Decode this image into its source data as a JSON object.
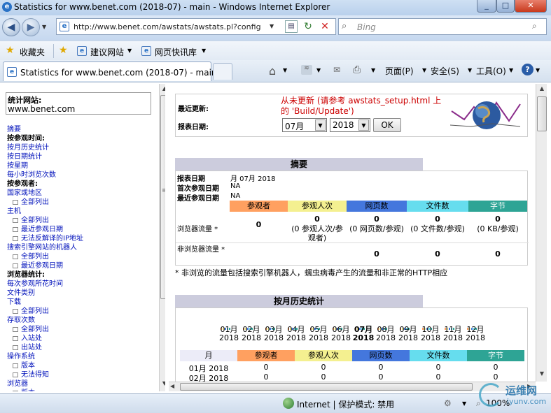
{
  "window": {
    "title": "Statistics for www.benet.com (2018-07) - main - Windows Internet Explorer"
  },
  "address": {
    "url": "http://www.benet.com/awstats/awstats.pl?config",
    "search_placeholder": "Bing"
  },
  "favorites": {
    "label": "收藏夹",
    "items": [
      "建议网站",
      "网页快讯库"
    ]
  },
  "tab": {
    "label": "Statistics for www.benet.com (2018-07) - main"
  },
  "commandbar": {
    "page": "页面(P)",
    "safety": "安全(S)",
    "tools": "工具(O)"
  },
  "sidebar": {
    "stats_label": "统计网站:",
    "site": "www.benet.com",
    "items": [
      {
        "text": "摘要",
        "kind": "link",
        "indent": false
      },
      {
        "text": "按参观时间:",
        "kind": "head",
        "indent": false
      },
      {
        "text": "按月历史统计",
        "kind": "link",
        "indent": false
      },
      {
        "text": "按日期统计",
        "kind": "link",
        "indent": false
      },
      {
        "text": "按星期",
        "kind": "link",
        "indent": false
      },
      {
        "text": "每小时浏览次数",
        "kind": "link",
        "indent": false
      },
      {
        "text": "按参观者:",
        "kind": "head",
        "indent": false
      },
      {
        "text": "国家或地区",
        "kind": "link",
        "indent": false
      },
      {
        "text": "全部列出",
        "kind": "link",
        "indent": true
      },
      {
        "text": "主机",
        "kind": "link",
        "indent": false
      },
      {
        "text": "全部列出",
        "kind": "link",
        "indent": true
      },
      {
        "text": "最近参观日期",
        "kind": "link",
        "indent": true
      },
      {
        "text": "无法反解译的IP地址",
        "kind": "link",
        "indent": true
      },
      {
        "text": "搜索引擎网站的机器人",
        "kind": "link",
        "indent": false
      },
      {
        "text": "全部列出",
        "kind": "link",
        "indent": true
      },
      {
        "text": "最近参观日期",
        "kind": "link",
        "indent": true
      },
      {
        "text": "浏览器统计:",
        "kind": "head",
        "indent": false
      },
      {
        "text": "每次参观所花时间",
        "kind": "link",
        "indent": false
      },
      {
        "text": "文件类别",
        "kind": "link",
        "indent": false
      },
      {
        "text": "下载",
        "kind": "link",
        "indent": false
      },
      {
        "text": "全部列出",
        "kind": "link",
        "indent": true
      },
      {
        "text": "存取次数",
        "kind": "link",
        "indent": false
      },
      {
        "text": "全部列出",
        "kind": "link",
        "indent": true
      },
      {
        "text": "入站处",
        "kind": "link",
        "indent": true
      },
      {
        "text": "出站处",
        "kind": "link",
        "indent": true
      },
      {
        "text": "操作系统",
        "kind": "link",
        "indent": false
      },
      {
        "text": "版本",
        "kind": "link",
        "indent": true
      },
      {
        "text": "无法得知",
        "kind": "link",
        "indent": true
      },
      {
        "text": "浏览器",
        "kind": "link",
        "indent": false
      },
      {
        "text": "版本",
        "kind": "link",
        "indent": true
      }
    ]
  },
  "main": {
    "last_update_label": "最近更新:",
    "last_update_value": "从未更新 (请参考 awstats_setup.html 上的 'Build/Update')",
    "report_date_label": "报表日期:",
    "month_value": "07月",
    "year_value": "2018",
    "ok_label": "OK",
    "summary": {
      "title": "摘要",
      "rows": [
        {
          "label": "报表日期",
          "value": "月 07月 2018"
        },
        {
          "label": "首次参观日期",
          "value": "NA"
        },
        {
          "label": "最近参观日期",
          "value": "NA"
        }
      ],
      "columns": [
        "参观者",
        "参观人次",
        "网页数",
        "文件数",
        "字节"
      ],
      "viewed_label": "浏览器流量 *",
      "viewed": [
        {
          "value": "0",
          "sub": ""
        },
        {
          "value": "0",
          "sub": "(0 参观人次/参观者)"
        },
        {
          "value": "0",
          "sub": "(0 网页数/参观)"
        },
        {
          "value": "0",
          "sub": "(0 文件数/参观)"
        },
        {
          "value": "0",
          "sub": "(0 KB/参观)"
        }
      ],
      "notviewed_label": "非浏览器流量 *",
      "notviewed": [
        "",
        "",
        "0",
        "0",
        "0"
      ],
      "footnote": "* 非浏览的流量包括搜索引擎机器人，蠕虫病毒产生的流量和非正常的HTTP相应"
    },
    "monthly": {
      "title": "按月历史统计",
      "months": [
        "01月",
        "02月",
        "03月",
        "04月",
        "05月",
        "06月",
        "07月",
        "08月",
        "09月",
        "10月",
        "11月",
        "12月"
      ],
      "year": "2018",
      "current_index": 6,
      "columns": [
        "月",
        "参观者",
        "参观人次",
        "网页数",
        "文件数",
        "字节"
      ],
      "rows": [
        {
          "month": "01月 2018",
          "values": [
            "0",
            "0",
            "0",
            "0",
            "0"
          ]
        },
        {
          "month": "02月 2018",
          "values": [
            "0",
            "0",
            "0",
            "0",
            "0"
          ]
        }
      ]
    }
  },
  "status": {
    "zone": "Internet | 保护模式: 禁用",
    "zoom": "100%"
  },
  "watermark": {
    "text": "运维网",
    "sub": "iyunv.com"
  }
}
